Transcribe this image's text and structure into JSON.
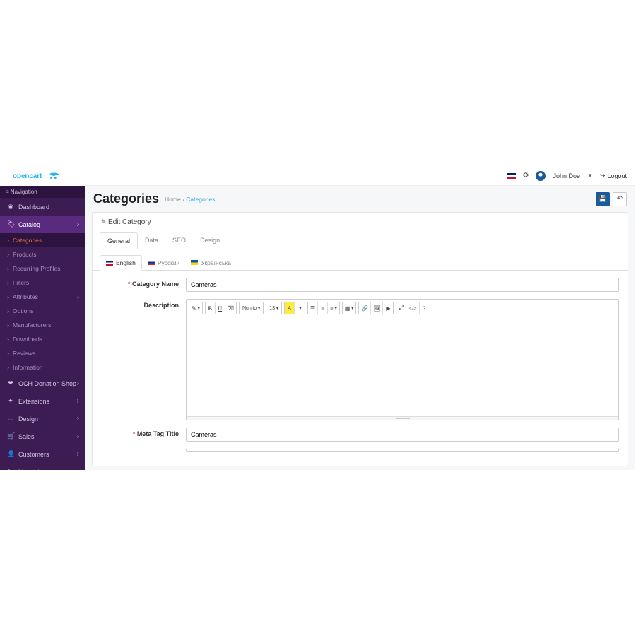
{
  "logo": "opencart",
  "header": {
    "user": "John Doe",
    "logout": "Logout"
  },
  "nav": {
    "title": "Navigation",
    "items": [
      {
        "label": "Dashboard",
        "icon": "◉"
      },
      {
        "label": "Catalog",
        "icon": "🏷",
        "active": true,
        "expand": true
      },
      {
        "label": "OCH Donation Shop",
        "icon": "❤",
        "expand": true
      },
      {
        "label": "Extensions",
        "icon": "✦",
        "expand": true
      },
      {
        "label": "Design",
        "icon": "▭",
        "expand": true
      },
      {
        "label": "Sales",
        "icon": "🛒",
        "expand": true
      },
      {
        "label": "Customers",
        "icon": "👤",
        "expand": true
      },
      {
        "label": "Marketing",
        "icon": "⇆",
        "expand": true
      }
    ],
    "catalog_sub": [
      {
        "label": "Categories",
        "active": true
      },
      {
        "label": "Products"
      },
      {
        "label": "Recurring Profiles"
      },
      {
        "label": "Filters"
      },
      {
        "label": "Attributes",
        "expand": true
      },
      {
        "label": "Options"
      },
      {
        "label": "Manufacturers"
      },
      {
        "label": "Downloads"
      },
      {
        "label": "Reviews"
      },
      {
        "label": "Information"
      }
    ]
  },
  "page": {
    "title": "Categories",
    "crumb_home": "Home",
    "crumb_cat": "Categories"
  },
  "panel": {
    "title": "Edit Category"
  },
  "tabs": [
    {
      "label": "General",
      "active": true
    },
    {
      "label": "Data"
    },
    {
      "label": "SEO"
    },
    {
      "label": "Design"
    }
  ],
  "langtabs": [
    {
      "label": "English",
      "active": true,
      "flag": "en"
    },
    {
      "label": "Русский",
      "flag": "ru"
    },
    {
      "label": "Українська",
      "flag": "ua"
    }
  ],
  "form": {
    "category_name_label": "Category Name",
    "category_name_value": "Cameras",
    "description_label": "Description",
    "meta_title_label": "Meta Tag Title",
    "meta_title_value": "Cameras"
  },
  "editor": {
    "font": "Nunito",
    "size": "13"
  }
}
